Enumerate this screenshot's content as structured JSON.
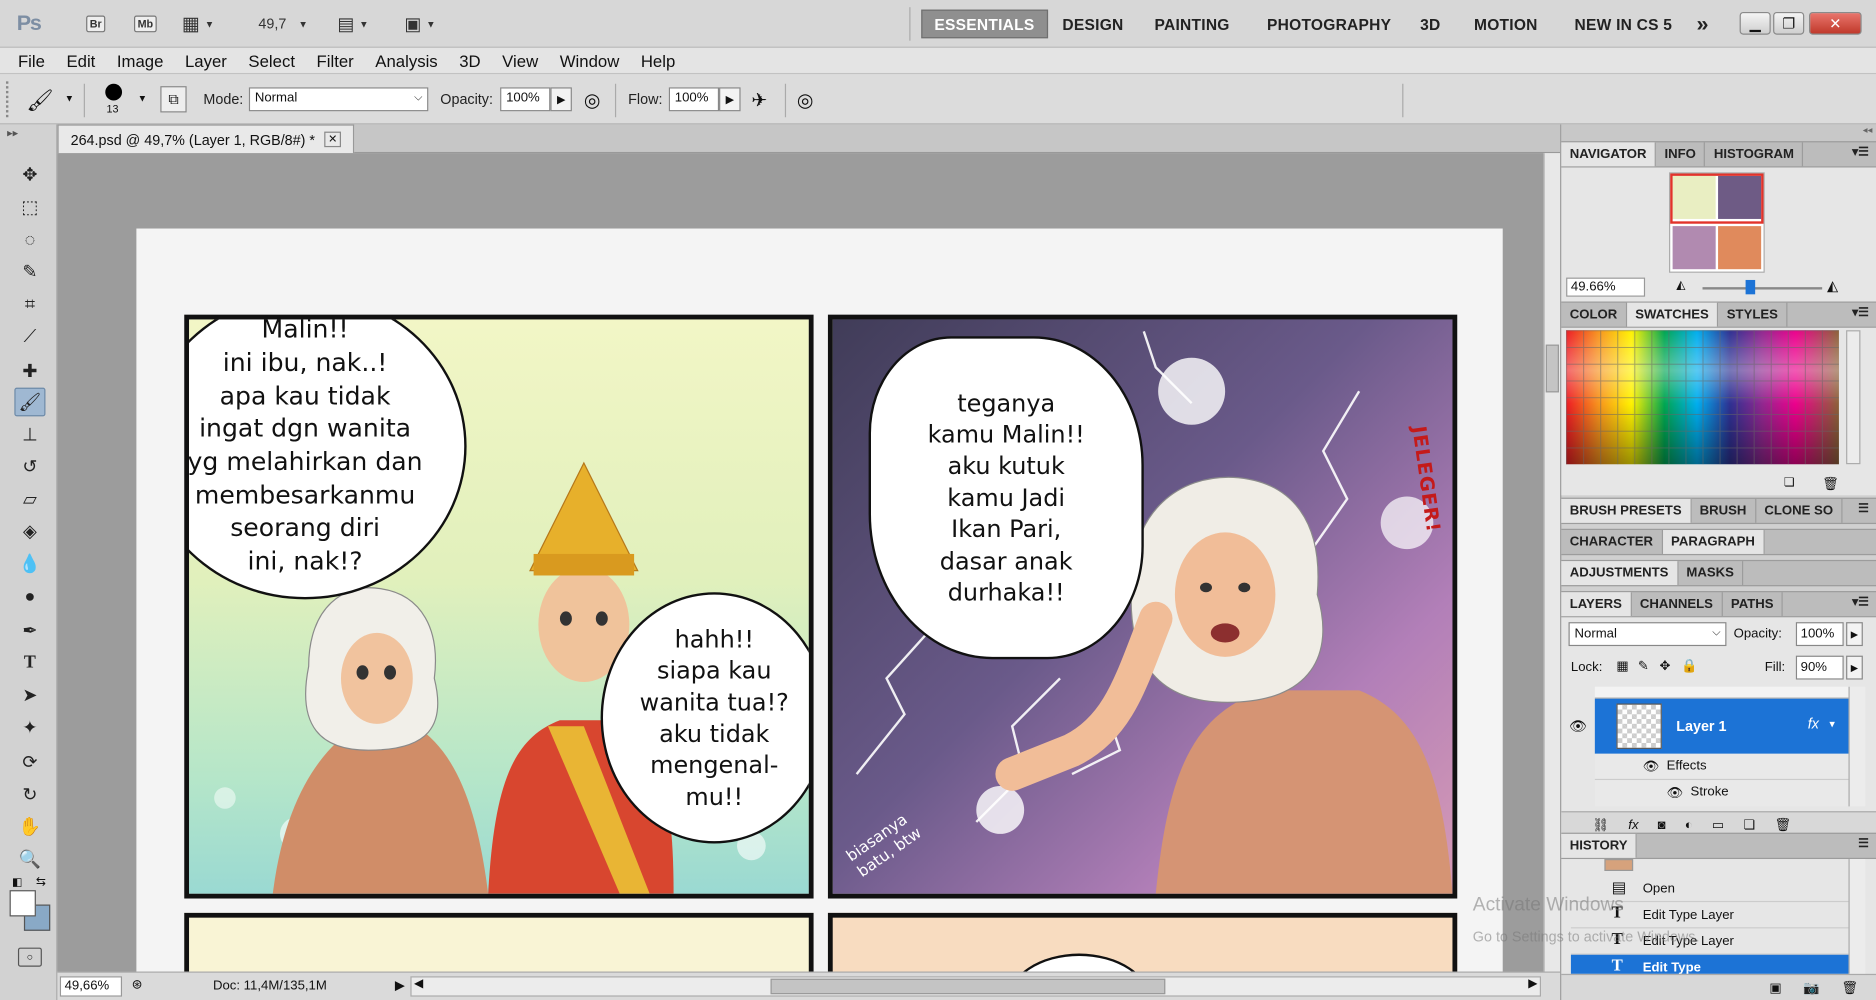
{
  "app": {
    "logo": "Ps",
    "bridge_label": "Br",
    "minibridge_label": "Mb",
    "zoom_value": "49,7",
    "workspaces": [
      "ESSENTIALS",
      "DESIGN",
      "PAINTING",
      "PHOTOGRAPHY",
      "3D",
      "MOTION",
      "NEW IN CS 5"
    ],
    "more_workspaces": "»"
  },
  "menu": [
    "File",
    "Edit",
    "Image",
    "Layer",
    "Select",
    "Filter",
    "Analysis",
    "3D",
    "View",
    "Window",
    "Help"
  ],
  "options": {
    "brush_size": "13",
    "mode_label": "Mode:",
    "mode_value": "Normal",
    "opacity_label": "Opacity:",
    "opacity_value": "100%",
    "flow_label": "Flow:",
    "flow_value": "100%"
  },
  "document": {
    "tab_title": "264.psd @ 49,7% (Layer 1, RGB/8#) *",
    "zoom": "49,66%",
    "doc_info": "Doc: 11,4M/135,1M"
  },
  "comic": {
    "bubble1": "Malin!!\nini ibu, nak..!\napa kau tidak\ningat dgn wanita\nyg melahirkan dan\nmembesarkanmu\nseorang diri\nini, nak!?",
    "bubble2": "hahh!!\nsiapa kau\nwanita tua!?\naku tidak\nmengenal-\nmu!!",
    "bubble3": "teganya\nkamu Malin!!\naku kutuk\nkamu Jadi\nIkan Pari,\ndasar anak\ndurhaka!!",
    "sfx": "JELEGER!",
    "footnote": "biasanya\nbatu, btw"
  },
  "panels": {
    "navigator_tabs": [
      "NAVIGATOR",
      "INFO",
      "HISTOGRAM"
    ],
    "navigator_zoom": "49.66%",
    "color_tabs": [
      "COLOR",
      "SWATCHES",
      "STYLES"
    ],
    "brush_tabs": [
      "BRUSH PRESETS",
      "BRUSH",
      "CLONE SO"
    ],
    "char_tabs": [
      "CHARACTER",
      "PARAGRAPH"
    ],
    "adj_tabs": [
      "ADJUSTMENTS",
      "MASKS"
    ],
    "layers_tabs": [
      "LAYERS",
      "CHANNELS",
      "PATHS"
    ],
    "blend_mode": "Normal",
    "opacity_label": "Opacity:",
    "opacity_value": "100%",
    "lock_label": "Lock:",
    "fill_label": "Fill:",
    "fill_value": "90%",
    "layer_name": "Layer 1",
    "effects_label": "Effects",
    "stroke_label": "Stroke",
    "history_tab": "HISTORY",
    "history_items": [
      "Open",
      "Edit Type Layer",
      "Edit Type Layer",
      "Edit Type"
    ],
    "watermark_line1": "Activate Windows",
    "watermark_line2": "Go to Settings to activate Windows."
  },
  "colors": {
    "accent": "#1c73d6",
    "swatches_row1": [
      "#ed1c24",
      "#f7941d",
      "#fff200",
      "#00a651",
      "#00aeef",
      "#2e3192",
      "#92278f",
      "#ec008c",
      "#ffffff",
      "#cccccc",
      "#999999",
      "#666666",
      "#333333",
      "#000000",
      "#f26c4f",
      "#fbaf5d"
    ]
  }
}
